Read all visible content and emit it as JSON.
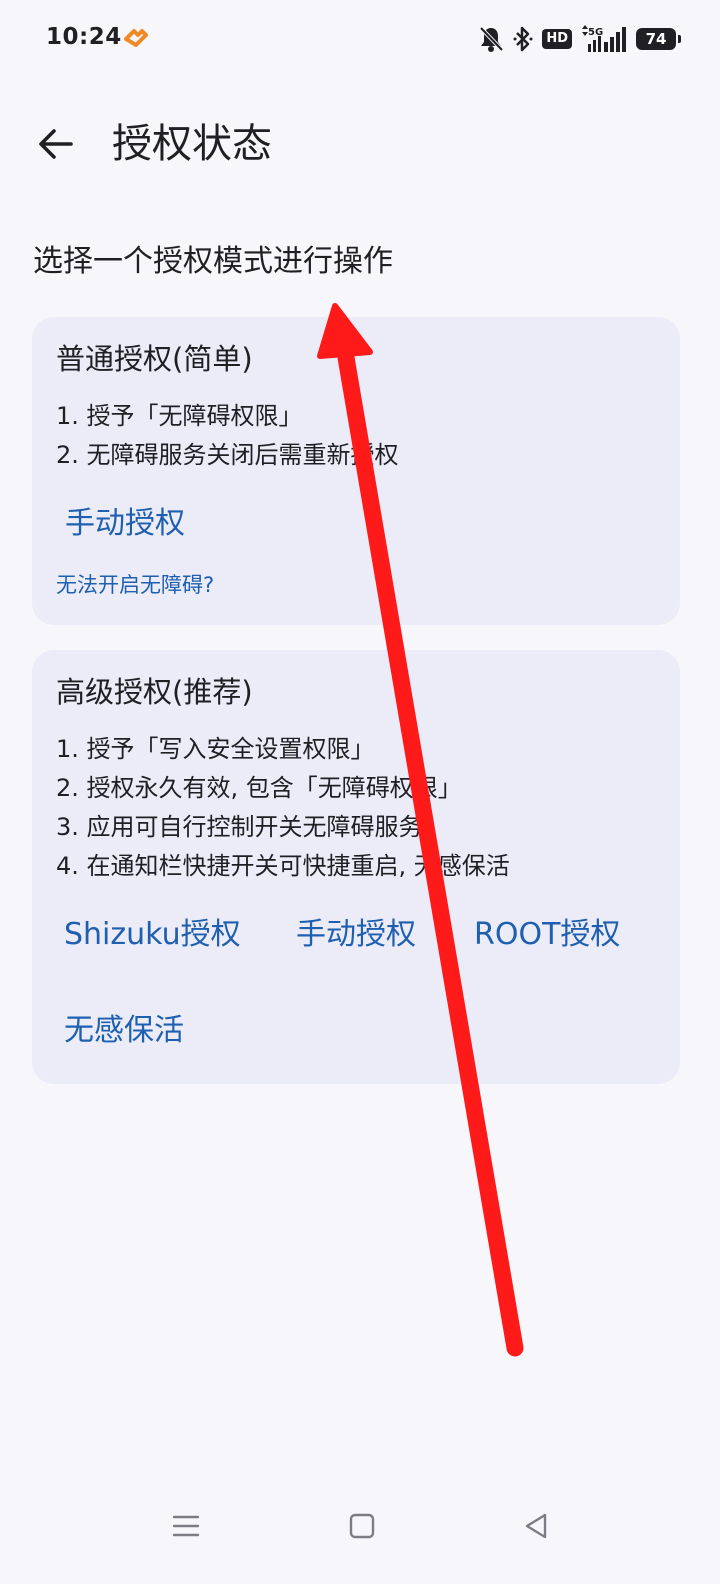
{
  "status_bar": {
    "time": "10:24",
    "hd": "HD",
    "network": "5G",
    "battery": "74"
  },
  "header": {
    "title": "授权状态"
  },
  "subtitle": "选择一个授权模式进行操作",
  "simple_card": {
    "title": "普通授权(简单)",
    "items": [
      "1. 授予「无障碍权限」",
      "2. 无障碍服务关闭后需重新授权"
    ],
    "manual_label": "手动授权",
    "help_link": "无法开启无障碍?"
  },
  "advanced_card": {
    "title": "高级授权(推荐)",
    "items": [
      "1. 授予「写入安全设置权限」",
      "2. 授权永久有效, 包含「无障碍权限」",
      "3. 应用可自行控制开关无障碍服务",
      "4. 在通知栏快捷开关可快捷重启, 无感保活"
    ],
    "shizuku_label": "Shizuku授权",
    "manual_label": "手动授权",
    "root_label": "ROOT授权",
    "keepalive_label": "无感保活"
  },
  "colors": {
    "accent": "#1f5fb0",
    "card_bg": "#ebecf8",
    "page_bg": "#f6f6fb",
    "annotation_arrow": "#ff1a1a"
  },
  "icons": {
    "back": "arrow-left-icon",
    "nav_menu": "menu-icon",
    "nav_home": "square-icon",
    "nav_back": "triangle-back-icon"
  }
}
